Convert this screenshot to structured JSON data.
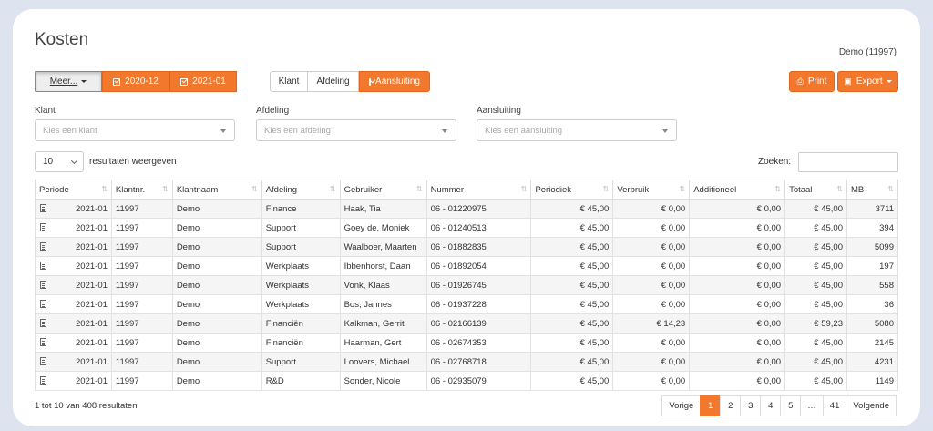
{
  "header": {
    "title": "Kosten",
    "user": "Demo (11997)"
  },
  "toolbar": {
    "more_label": "Meer...",
    "periods": [
      "2020-12",
      "2021-01"
    ],
    "view_tabs": [
      {
        "label": "Klant",
        "active": false
      },
      {
        "label": "Afdeling",
        "active": false
      },
      {
        "label": "Aansluiting",
        "active": true
      }
    ],
    "print_label": "Print",
    "export_label": "Export"
  },
  "filters": [
    {
      "label": "Klant",
      "placeholder": "Kies een klant"
    },
    {
      "label": "Afdeling",
      "placeholder": "Kies een afdeling"
    },
    {
      "label": "Aansluiting",
      "placeholder": "Kies een aansluiting"
    }
  ],
  "table_controls": {
    "page_length": "10",
    "length_suffix": "resultaten weergeven",
    "search_label": "Zoeken:"
  },
  "table": {
    "columns": [
      "Periode",
      "Klantnr.",
      "Klantnaam",
      "Afdeling",
      "Gebruiker",
      "Nummer",
      "Periodiek",
      "Verbruik",
      "Additioneel",
      "Totaal",
      "MB"
    ],
    "rows": [
      [
        "2021-01",
        "11997",
        "Demo",
        "Finance",
        "Haak, Tia",
        "06 - 01220975",
        "€ 45,00",
        "€ 0,00",
        "€ 0,00",
        "€ 45,00",
        "3711"
      ],
      [
        "2021-01",
        "11997",
        "Demo",
        "Support",
        "Goey de, Moniek",
        "06 - 01240513",
        "€ 45,00",
        "€ 0,00",
        "€ 0,00",
        "€ 45,00",
        "394"
      ],
      [
        "2021-01",
        "11997",
        "Demo",
        "Support",
        "Waalboer, Maarten",
        "06 - 01882835",
        "€ 45,00",
        "€ 0,00",
        "€ 0,00",
        "€ 45,00",
        "5099"
      ],
      [
        "2021-01",
        "11997",
        "Demo",
        "Werkplaats",
        "Ibbenhorst, Daan",
        "06 - 01892054",
        "€ 45,00",
        "€ 0,00",
        "€ 0,00",
        "€ 45,00",
        "197"
      ],
      [
        "2021-01",
        "11997",
        "Demo",
        "Werkplaats",
        "Vonk, Klaas",
        "06 - 01926745",
        "€ 45,00",
        "€ 0,00",
        "€ 0,00",
        "€ 45,00",
        "558"
      ],
      [
        "2021-01",
        "11997",
        "Demo",
        "Werkplaats",
        "Bos, Jannes",
        "06 - 01937228",
        "€ 45,00",
        "€ 0,00",
        "€ 0,00",
        "€ 45,00",
        "36"
      ],
      [
        "2021-01",
        "11997",
        "Demo",
        "Financiën",
        "Kalkman, Gerrit",
        "06 - 02166139",
        "€ 45,00",
        "€ 14,23",
        "€ 0,00",
        "€ 59,23",
        "5080"
      ],
      [
        "2021-01",
        "11997",
        "Demo",
        "Financiën",
        "Haarman, Gert",
        "06 - 02674353",
        "€ 45,00",
        "€ 0,00",
        "€ 0,00",
        "€ 45,00",
        "2145"
      ],
      [
        "2021-01",
        "11997",
        "Demo",
        "Support",
        "Loovers, Michael",
        "06 - 02768718",
        "€ 45,00",
        "€ 0,00",
        "€ 0,00",
        "€ 45,00",
        "4231"
      ],
      [
        "2021-01",
        "11997",
        "Demo",
        "R&D",
        "Sonder, Nicole",
        "06 - 02935079",
        "€ 45,00",
        "€ 0,00",
        "€ 0,00",
        "€ 45,00",
        "1149"
      ]
    ]
  },
  "footer": {
    "info": "1 tot 10 van 408 resultaten",
    "pagination": [
      "Vorige",
      "1",
      "2",
      "3",
      "4",
      "5",
      "…",
      "41",
      "Volgende"
    ],
    "active_page": "1"
  },
  "colors": {
    "accent": "#f2782e"
  }
}
